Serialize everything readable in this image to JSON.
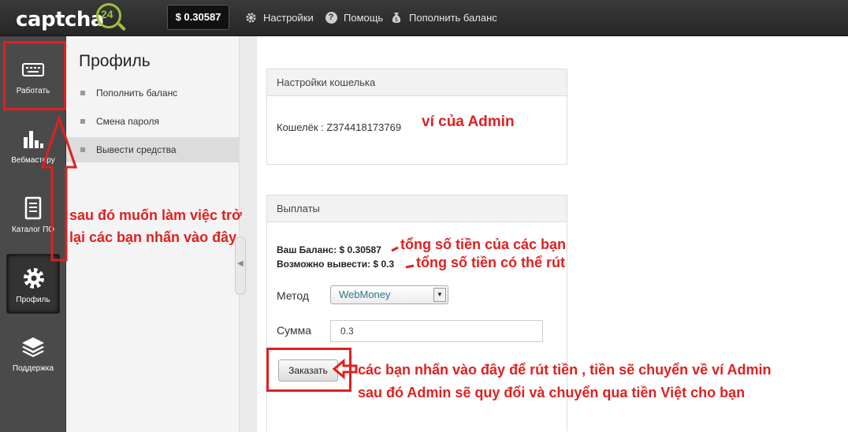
{
  "topbar": {
    "logo": "captcha",
    "logo_badge": "24",
    "balance": "$ 0.30587",
    "nav": [
      {
        "label": "Настройки",
        "icon": "gear-icon"
      },
      {
        "label": "Помощь",
        "icon": "help-icon"
      },
      {
        "label": "Пополнить баланс",
        "icon": "money-bag-icon"
      }
    ]
  },
  "sidebar": {
    "items": [
      {
        "label": "Работать",
        "icon": "keyboard-icon"
      },
      {
        "label": "Вебмастеру",
        "icon": "bar-chart-icon"
      },
      {
        "label": "Каталог ПО",
        "icon": "document-icon"
      },
      {
        "label": "Профиль",
        "icon": "gear-icon"
      },
      {
        "label": "Поддержка",
        "icon": "layers-icon"
      }
    ]
  },
  "submenu": {
    "title": "Профиль",
    "items": [
      {
        "label": "Пополнить баланс"
      },
      {
        "label": "Смена пароля"
      },
      {
        "label": "Вывести средства"
      }
    ]
  },
  "wallet_panel": {
    "title": "Настройки кошелька",
    "wallet_label": "Кошелёк : Z374418173769"
  },
  "payout_panel": {
    "title": "Выплаты",
    "balance_line": "Ваш Баланс: $ 0.30587",
    "withdrawable_line": "Возможно вывести: $ 0.3",
    "method_label": "Метод",
    "method_value": "WebMoney",
    "amount_label": "Сумма",
    "amount_value": "0.3",
    "order_button": "Заказать"
  },
  "annotations": {
    "wallet_note": "ví của Admin",
    "work_note_1": "sau đó muốn làm việc trở",
    "work_note_2": "lại các bạn nhấn vào đây",
    "balance_note": "tổng số tiền của các bạn",
    "withdraw_note": "tổng số tiền có thể rút",
    "order_note_1": "các bạn nhấn vào đây để rút tiền , tiền sẽ chuyển về ví Admin",
    "order_note_2": "sau đó Admin sẽ quy đổi và chuyển qua tiền Việt cho bạn"
  },
  "colors": {
    "annotation": "#e02020",
    "topbar": "#2c2c2c",
    "sidebar": "#4a4a4a",
    "logo_accent": "#9bc43a",
    "select_text": "#2a7a8a"
  }
}
